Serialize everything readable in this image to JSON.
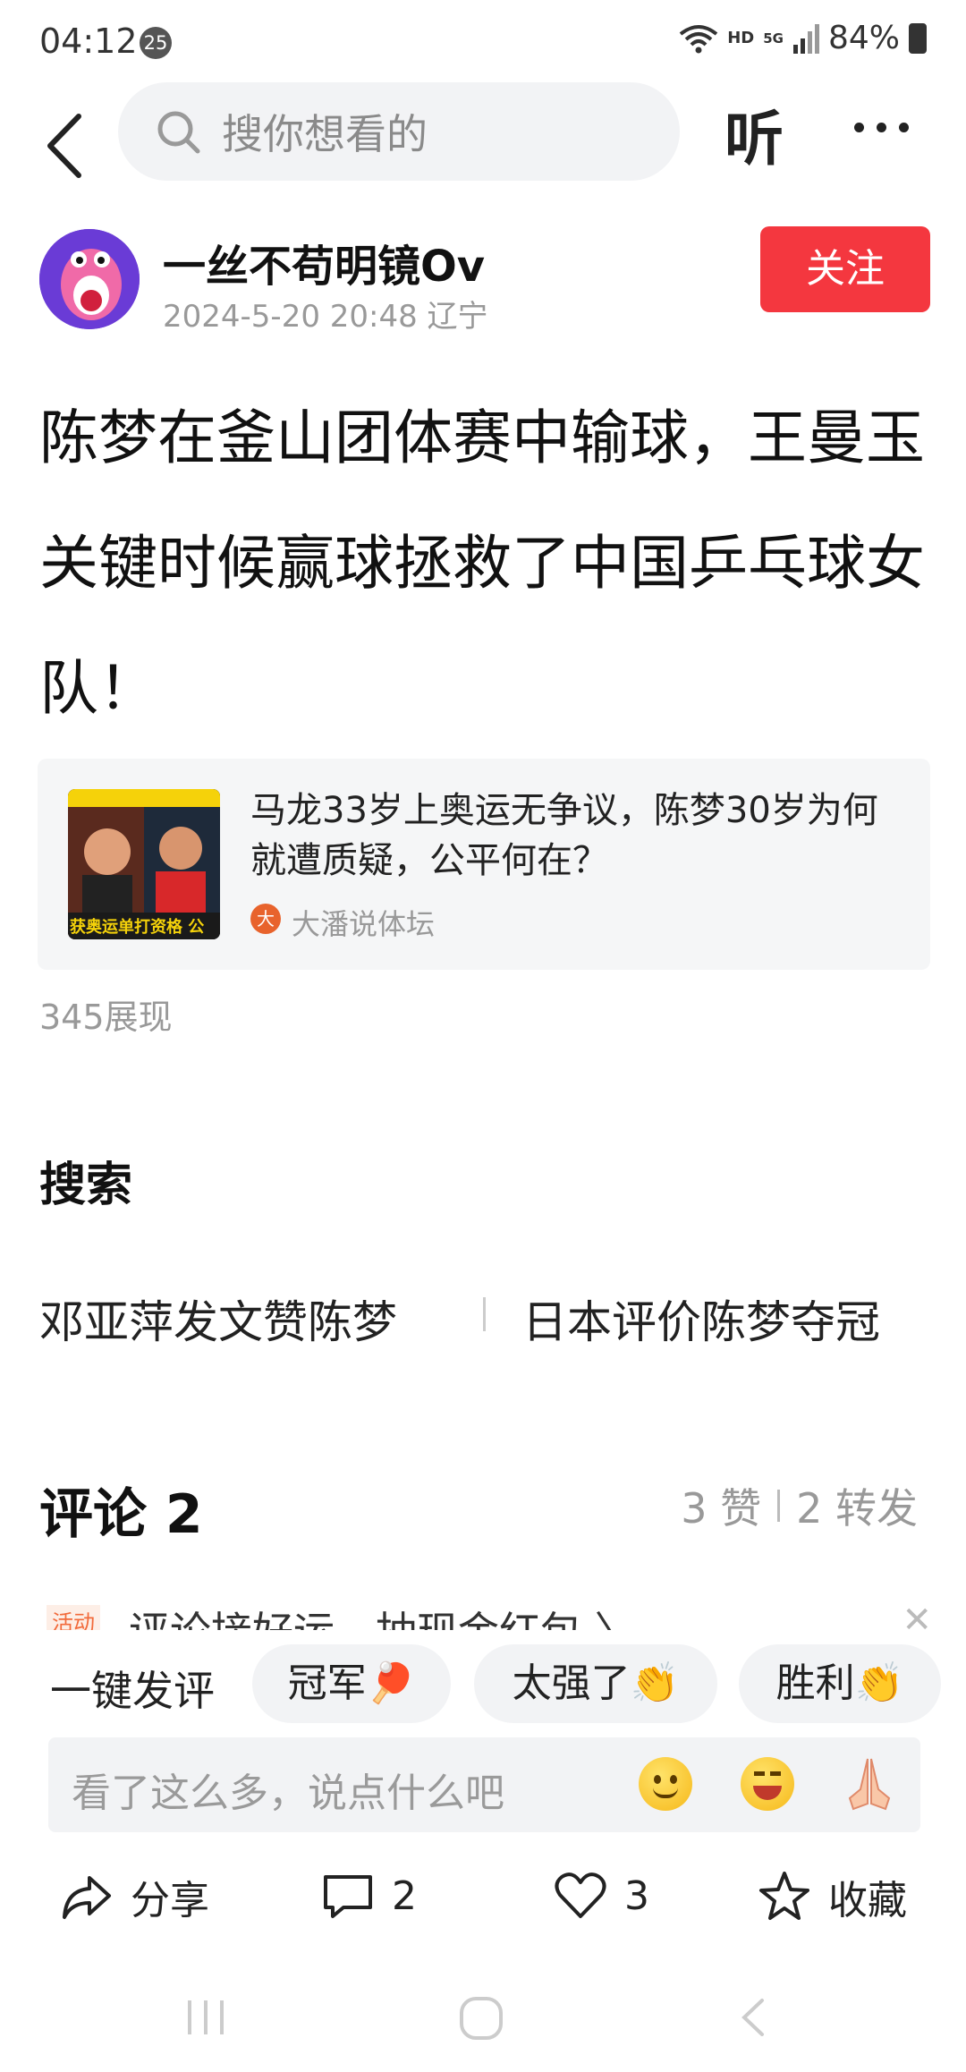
{
  "status_bar": {
    "time": "04:12",
    "badge": "25",
    "hd": "HD",
    "network": "5G",
    "battery": "84%"
  },
  "top_bar": {
    "search_placeholder": "搜你想看的",
    "listen_label": "听"
  },
  "author": {
    "name": "一丝不苟明镜Ov",
    "meta": "2024-5-20 20:48 辽宁",
    "follow_label": "关注"
  },
  "article": {
    "title": "陈梦在釜山团体赛中输球，王曼玉关键时候赢球拯救了中国乒乓球女队！"
  },
  "related_card": {
    "title": "马龙33岁上奥运无争议，陈梦30岁为何就遭质疑，公平何在？",
    "source": "大潘说体坛",
    "thumb_caption": "获奥运单打资格 公"
  },
  "views": "345展现",
  "search_section": {
    "heading": "搜索",
    "suggestions": [
      "邓亚萍发文赞陈梦",
      "日本评价陈梦夺冠"
    ]
  },
  "comments": {
    "title": "评论 2",
    "likes": "3 赞",
    "reposts": "2 转发",
    "promo_tag": "活动",
    "promo_text": "评论接好运，抽现金红包 〉",
    "quick_label": "一键发评",
    "chips": [
      "冠军🏓",
      "太强了👏",
      "胜利👏"
    ],
    "input_placeholder": "看了这么多，说点什么吧"
  },
  "actions": {
    "share": "分享",
    "comment_count": "2",
    "like_count": "3",
    "favorite": "收藏"
  },
  "colors": {
    "follow_button": "#f4373f",
    "input_bg": "#f2f3f5",
    "meta_gray": "#999999"
  }
}
